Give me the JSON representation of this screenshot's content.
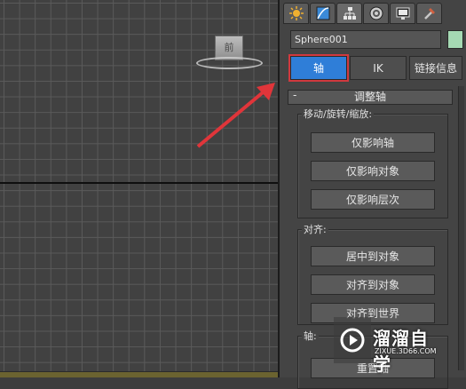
{
  "viewport": {
    "viewcube_face": "前"
  },
  "panel": {
    "tabs": [
      {
        "icon": "create-icon"
      },
      {
        "icon": "modify-icon"
      },
      {
        "icon": "hierarchy-icon"
      },
      {
        "icon": "motion-icon"
      },
      {
        "icon": "display-icon"
      },
      {
        "icon": "utilities-icon"
      }
    ],
    "object_name": "Sphere001",
    "object_color": "#a5d9b3",
    "mode_buttons": {
      "pivot": "轴",
      "ik": "IK",
      "link_info": "链接信息"
    },
    "rollout": {
      "collapse": "-",
      "title": "调整轴"
    },
    "move_group": {
      "label": "移动/旋转/缩放:",
      "buttons": [
        "仅影响轴",
        "仅影响对象",
        "仅影响层次"
      ]
    },
    "align_group": {
      "label": "对齐:",
      "buttons": [
        "居中到对象",
        "对齐到对象",
        "对齐到世界"
      ]
    },
    "axis_group": {
      "label": "轴:",
      "buttons": [
        "重置轴"
      ]
    }
  },
  "watermark": {
    "brand": "溜溜自学",
    "url": "ZIXUE.3D66.COM"
  },
  "colors": {
    "accent_button": "#2f7ed8",
    "highlight_border": "#d0393e",
    "arrow": "#e0353a"
  }
}
